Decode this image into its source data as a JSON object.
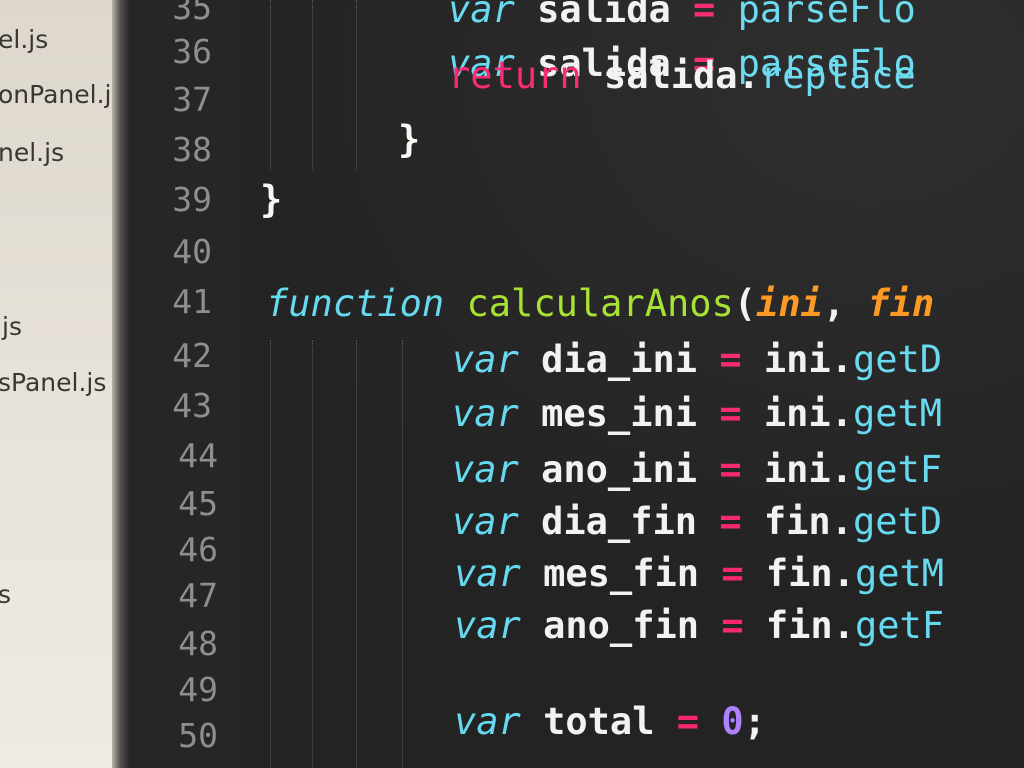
{
  "sidebar": {
    "files": [
      {
        "label": "el.js"
      },
      {
        "label": "onPanel.js"
      },
      {
        "label": "nel.js"
      },
      {
        "label": "js"
      },
      {
        "label": "sPanel.js"
      },
      {
        "label": "s"
      }
    ]
  },
  "editor": {
    "lines": [
      {
        "number": "35",
        "tokens": [
          {
            "t": "var",
            "c": "kw"
          },
          {
            "t": " salida ",
            "c": "plain"
          },
          {
            "t": "=",
            "c": "op"
          },
          {
            "t": " parseFlo",
            "c": "method"
          }
        ]
      },
      {
        "number": "36",
        "tokens": [
          {
            "t": "var",
            "c": "kw"
          },
          {
            "t": " salida ",
            "c": "plain"
          },
          {
            "t": "=",
            "c": "op"
          },
          {
            "t": " parseFlo",
            "c": "method"
          }
        ]
      },
      {
        "number": "37",
        "tokens": [
          {
            "t": "return",
            "c": "ret"
          },
          {
            "t": " salida.",
            "c": "plain"
          },
          {
            "t": "replace",
            "c": "method"
          }
        ]
      },
      {
        "number": "38",
        "tokens": [
          {
            "t": "}",
            "c": "brace"
          }
        ]
      },
      {
        "number": "39",
        "tokens": [
          {
            "t": "}",
            "c": "brace"
          }
        ]
      },
      {
        "number": "40",
        "tokens": []
      },
      {
        "number": "41",
        "tokens": [
          {
            "t": "function",
            "c": "kw"
          },
          {
            "t": " ",
            "c": "plain"
          },
          {
            "t": "calcularAnos",
            "c": "fn"
          },
          {
            "t": "(",
            "c": "plain"
          },
          {
            "t": "ini",
            "c": "param"
          },
          {
            "t": ", ",
            "c": "plain"
          },
          {
            "t": "fin",
            "c": "param"
          }
        ]
      },
      {
        "number": "42",
        "tokens": [
          {
            "t": "var",
            "c": "kw"
          },
          {
            "t": " dia_ini ",
            "c": "plain"
          },
          {
            "t": "=",
            "c": "op"
          },
          {
            "t": " ini.",
            "c": "plain"
          },
          {
            "t": "getD",
            "c": "method"
          }
        ]
      },
      {
        "number": "43",
        "tokens": [
          {
            "t": "var",
            "c": "kw"
          },
          {
            "t": " mes_ini ",
            "c": "plain"
          },
          {
            "t": "=",
            "c": "op"
          },
          {
            "t": " ini.",
            "c": "plain"
          },
          {
            "t": "getM",
            "c": "method"
          }
        ]
      },
      {
        "number": "44",
        "tokens": [
          {
            "t": "var",
            "c": "kw"
          },
          {
            "t": " ano_ini ",
            "c": "plain"
          },
          {
            "t": "=",
            "c": "op"
          },
          {
            "t": " ini.",
            "c": "plain"
          },
          {
            "t": "getF",
            "c": "method"
          }
        ]
      },
      {
        "number": "45",
        "tokens": [
          {
            "t": "var",
            "c": "kw"
          },
          {
            "t": " dia_fin ",
            "c": "plain"
          },
          {
            "t": "=",
            "c": "op"
          },
          {
            "t": " fin.",
            "c": "plain"
          },
          {
            "t": "getD",
            "c": "method"
          }
        ]
      },
      {
        "number": "46",
        "tokens": [
          {
            "t": "var",
            "c": "kw"
          },
          {
            "t": " mes_fin ",
            "c": "plain"
          },
          {
            "t": "=",
            "c": "op"
          },
          {
            "t": " fin.",
            "c": "plain"
          },
          {
            "t": "getM",
            "c": "method"
          }
        ]
      },
      {
        "number": "47",
        "tokens": [
          {
            "t": "var",
            "c": "kw"
          },
          {
            "t": " ano_fin ",
            "c": "plain"
          },
          {
            "t": "=",
            "c": "op"
          },
          {
            "t": " fin.",
            "c": "plain"
          },
          {
            "t": "getF",
            "c": "method"
          }
        ]
      },
      {
        "number": "48",
        "tokens": []
      },
      {
        "number": "49",
        "tokens": [
          {
            "t": "var",
            "c": "kw"
          },
          {
            "t": " total ",
            "c": "plain"
          },
          {
            "t": "=",
            "c": "op"
          },
          {
            "t": " ",
            "c": "plain"
          },
          {
            "t": "0",
            "c": "num"
          },
          {
            "t": ";",
            "c": "plain"
          }
        ]
      },
      {
        "number": "50",
        "tokens": []
      }
    ]
  },
  "colors": {
    "keyword": "#66d9ef",
    "return": "#f92672",
    "function_name": "#a6e22e",
    "parameter": "#fd971f",
    "operator": "#f92672",
    "number": "#ae81ff",
    "text": "#f2f2f2",
    "line_number": "#8e8e8e",
    "editor_background": "#232323",
    "sidebar_background": "#e6e1d8"
  }
}
